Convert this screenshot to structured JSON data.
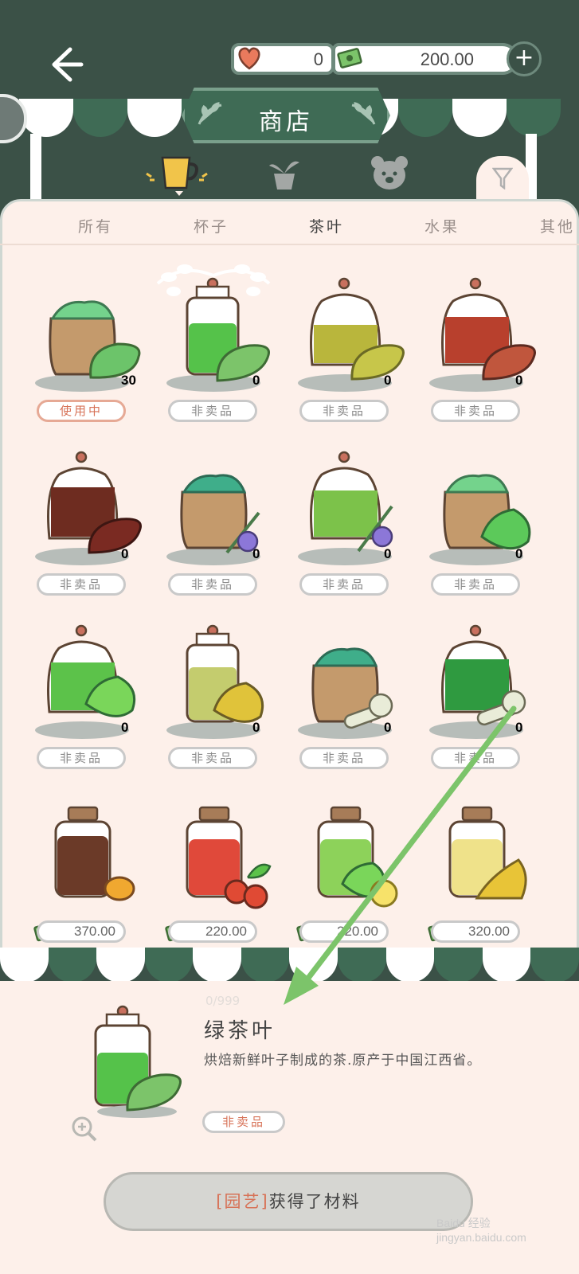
{
  "header": {
    "hearts": "0",
    "money": "200.00",
    "shop_title": "商店"
  },
  "tabs": [
    {
      "label": "所有"
    },
    {
      "label": "杯子"
    },
    {
      "label": "茶叶"
    },
    {
      "label": "水果"
    },
    {
      "label": "其他"
    }
  ],
  "items": [
    {
      "count": "30",
      "status": "使用中"
    },
    {
      "count": "0",
      "status": "非卖品"
    },
    {
      "count": "0",
      "status": "非卖品"
    },
    {
      "count": "0",
      "status": "非卖品"
    },
    {
      "count": "0",
      "status": "非卖品"
    },
    {
      "count": "0",
      "status": "非卖品"
    },
    {
      "count": "0",
      "status": "非卖品"
    },
    {
      "count": "0",
      "status": "非卖品"
    },
    {
      "count": "0",
      "status": "非卖品"
    },
    {
      "count": "0",
      "status": "非卖品"
    },
    {
      "count": "0",
      "status": "非卖品"
    },
    {
      "count": "0",
      "status": "非卖品"
    },
    {
      "price": "370.00"
    },
    {
      "price": "220.00"
    },
    {
      "price": "220.00"
    },
    {
      "price": "320.00"
    }
  ],
  "detail": {
    "count": "0/999",
    "name": "绿茶叶",
    "description": "烘焙新鲜叶子制成的茶.原产于中国江西省。",
    "status": "非卖品",
    "action_tag": "[园艺]",
    "action_text": "获得了材料"
  },
  "watermark": "Baidu 经验 jingyan.baidu.com",
  "colors": {
    "dark_green": "#3b5147",
    "awning_green": "#3f6b55",
    "panel_bg": "#fdf0ea",
    "accent_orange": "#d77257"
  }
}
